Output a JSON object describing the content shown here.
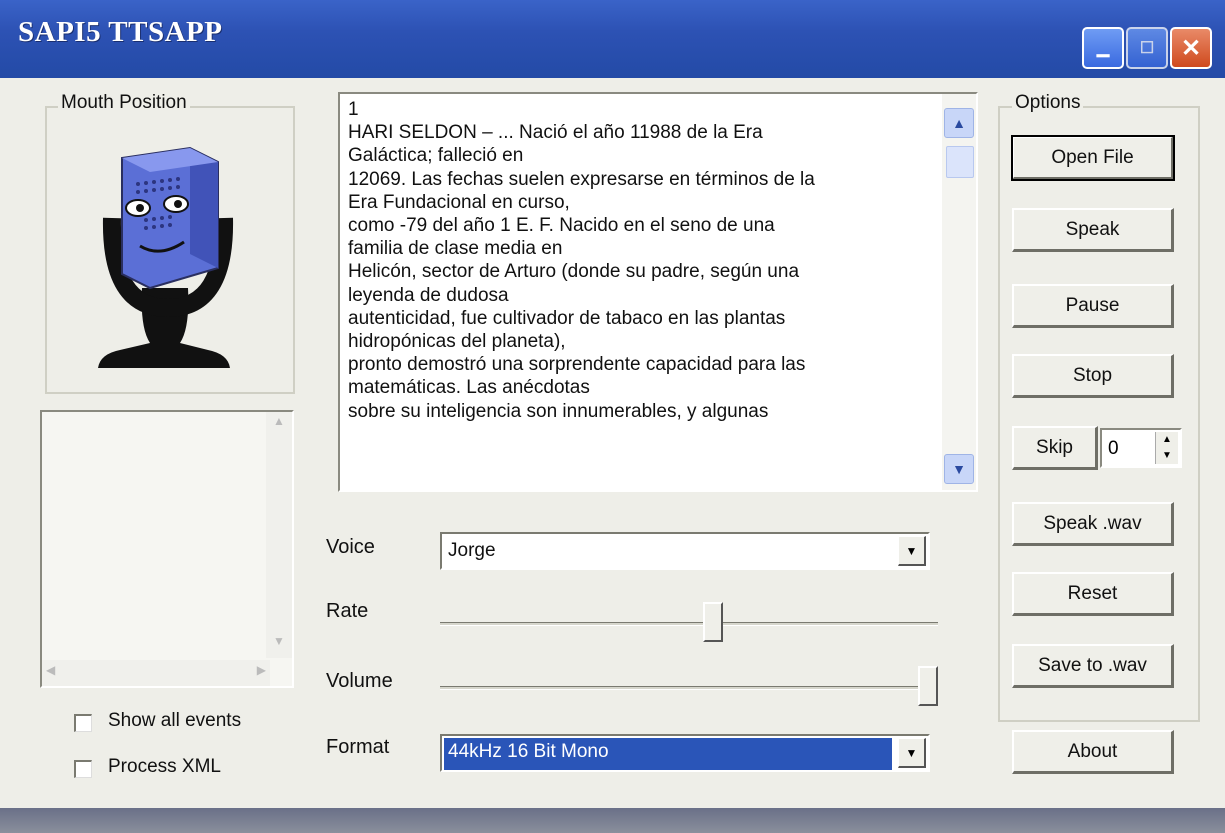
{
  "window": {
    "title": "SAPI5 TTSAPP",
    "minimize": "_",
    "maximize": "□",
    "close": "✕"
  },
  "mouth_panel": {
    "label": "Mouth Position"
  },
  "text_content": "1\nHARI SELDON – ... Nació el año 11988 de la Era\nGaláctica; falleció en\n12069. Las fechas suelen expresarse en términos de la\nEra Fundacional en curso,\ncomo -79 del año 1 E. F. Nacido en el seno de una\nfamilia de clase media en\nHelicón, sector de Arturo (donde su padre, según una\nleyenda de dudosa\nautenticidad, fue cultivador de tabaco en las plantas\nhidropónicas del planeta),\npronto demostró una sorprendente capacidad para las\nmatemáticas. Las anécdotas\nsobre su inteligencia son innumerables, y algunas",
  "controls": {
    "voice_label": "Voice",
    "voice_value": "Jorge",
    "rate_label": "Rate",
    "rate_level": 0.55,
    "volume_label": "Volume",
    "volume_level": 1.0,
    "format_label": "Format",
    "format_value": "44kHz 16 Bit Mono"
  },
  "checkboxes": {
    "show_all_events": "Show all events",
    "process_xml": "Process XML"
  },
  "options": {
    "label": "Options",
    "open_file": "Open File",
    "speak": "Speak",
    "pause": "Pause",
    "stop": "Stop",
    "skip": "Skip",
    "skip_value": "0",
    "speak_wav": "Speak .wav",
    "reset": "Reset",
    "save_wav": "Save to .wav",
    "about": "About"
  },
  "colors": {
    "title_bar": "#2d52b4",
    "selection": "#2a55b8",
    "mouth_blue": "#5b6fd6"
  }
}
